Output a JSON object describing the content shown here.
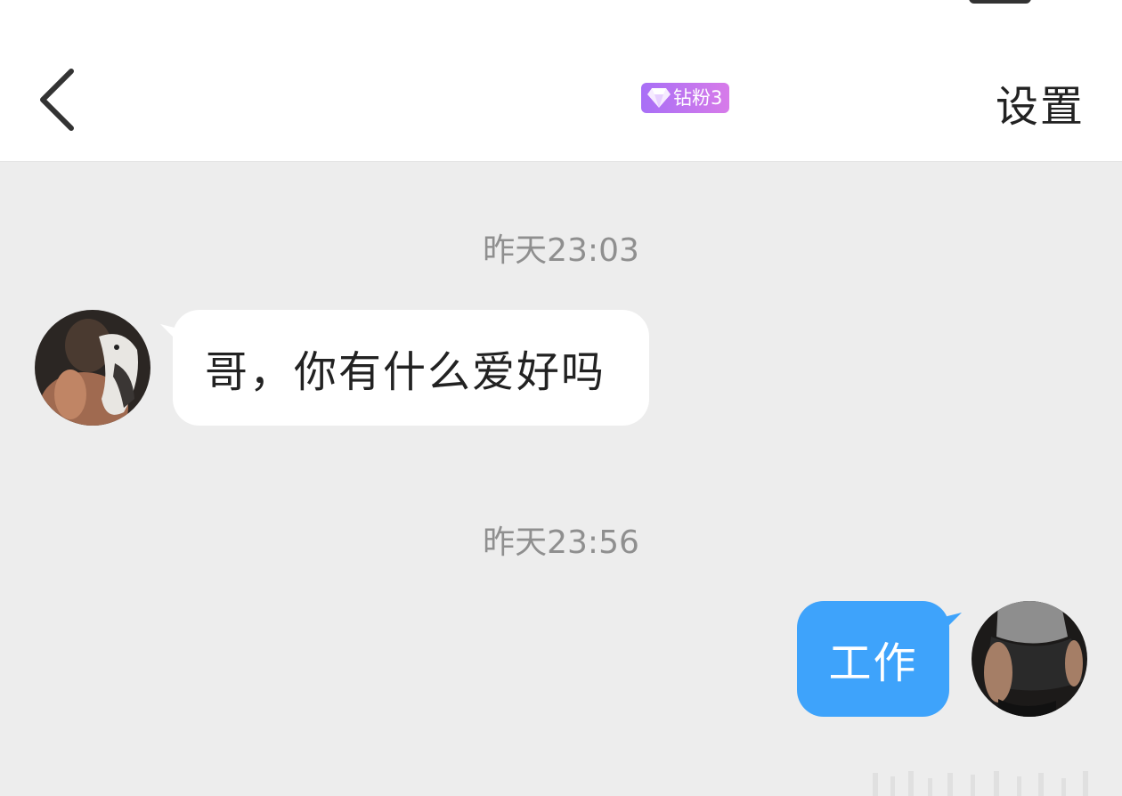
{
  "header": {
    "fan_badge": "钻粉3",
    "settings_label": "设置"
  },
  "messages": [
    {
      "timestamp": "昨天23:03",
      "direction": "incoming",
      "text": "哥，你有什么爱好吗"
    },
    {
      "timestamp": "昨天23:56",
      "direction": "outgoing",
      "text": "工作"
    }
  ],
  "colors": {
    "background": "#ededed",
    "header_bg": "#ffffff",
    "outgoing_bubble": "#3ea3fb",
    "incoming_bubble": "#ffffff",
    "badge_gradient_start": "#a86ff6",
    "badge_gradient_end": "#d77be9",
    "timestamp_text": "#8f8f8f"
  },
  "icons": {
    "back": "chevron-left-icon",
    "badge": "diamond-icon"
  }
}
